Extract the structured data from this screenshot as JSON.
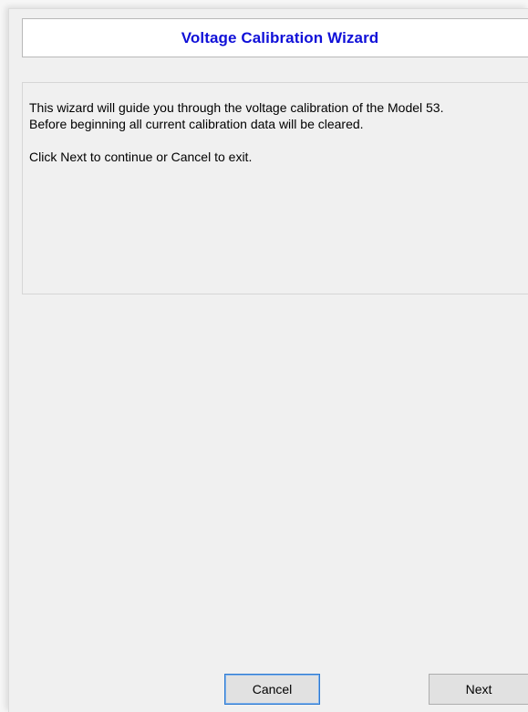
{
  "wizard": {
    "title": "Voltage Calibration Wizard",
    "intro_line1": "This wizard will guide you through the voltage calibration of the Model 53.",
    "intro_line2": "Before beginning all current calibration data will be cleared.",
    "instruction": "Click Next to continue or Cancel to exit."
  },
  "buttons": {
    "cancel_label": "Cancel",
    "next_label": "Next"
  },
  "colors": {
    "title": "#1010d8",
    "focus_border": "#2e7ad1"
  }
}
